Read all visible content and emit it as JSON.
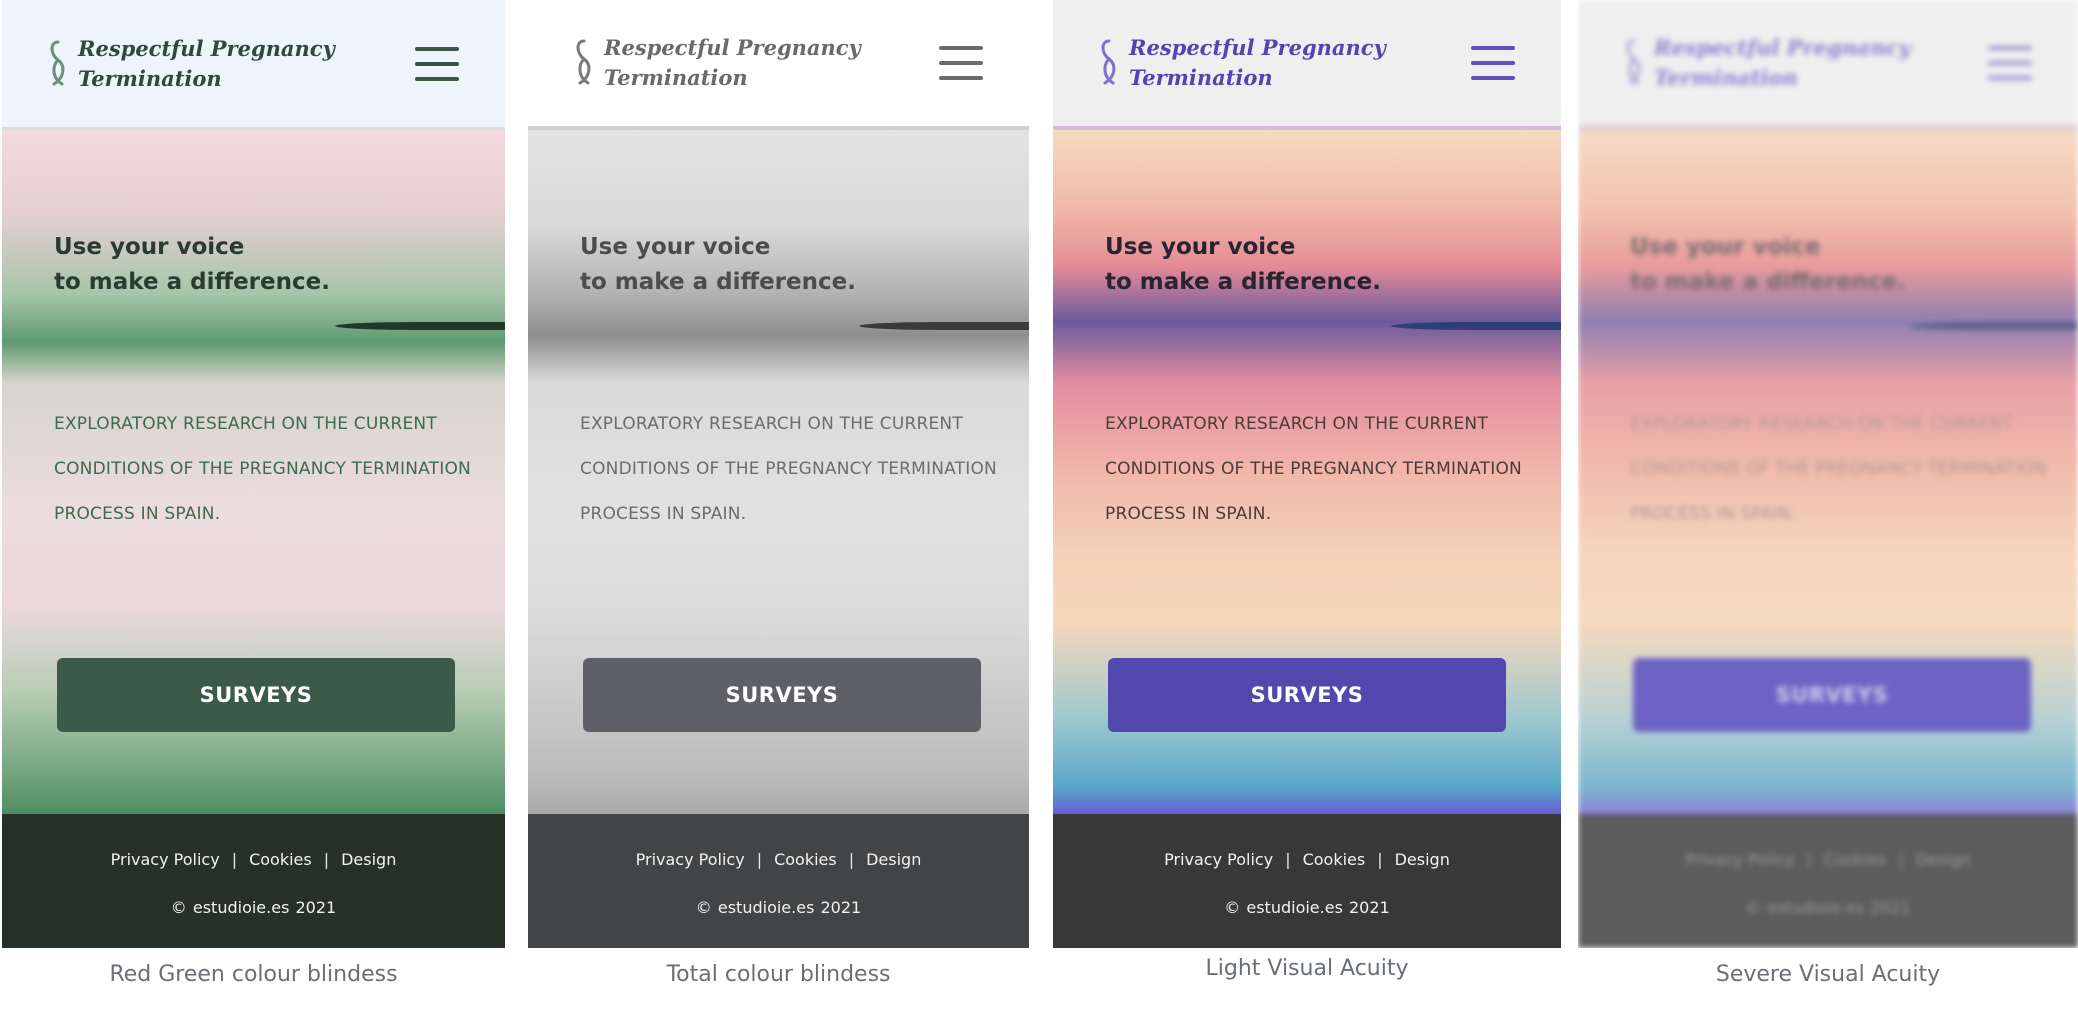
{
  "panels": [
    {
      "brand": "Respectful Pregnancy Termination",
      "tagline_line1": "Use your voice",
      "tagline_line2": "to make a difference.",
      "research_text": "EXPLORATORY RESEARCH ON THE CURRENT CONDITIONS OF THE PREGNANCY TERMINATION PROCESS IN SPAIN.",
      "surveys_button": "SURVEYS",
      "footer_links": [
        "Privacy Policy",
        "Cookies",
        "Design"
      ],
      "copyright": "© estudioie.es   2021",
      "caption": "Red Green colour blindess",
      "accent_color": "#3c5a48"
    },
    {
      "brand": "Respectful Pregnancy Termination",
      "tagline_line1": "Use your voice",
      "tagline_line2": "to make a difference.",
      "research_text": "EXPLORATORY RESEARCH ON THE CURRENT CONDITIONS OF THE PREGNANCY TERMINATION PROCESS IN SPAIN.",
      "surveys_button": "SURVEYS",
      "footer_links": [
        "Privacy Policy",
        "Cookies",
        "Design"
      ],
      "copyright": "© estudioie.es   2021",
      "caption": "Total colour blindess",
      "accent_color": "#5f6066"
    },
    {
      "brand": "Respectful Pregnancy Termination",
      "tagline_line1": "Use your voice",
      "tagline_line2": "to make a difference.",
      "research_text": "EXPLORATORY RESEARCH ON THE CURRENT CONDITIONS OF THE PREGNANCY TERMINATION PROCESS IN SPAIN.",
      "surveys_button": "SURVEYS",
      "footer_links": [
        "Privacy Policy",
        "Cookies",
        "Design"
      ],
      "copyright": "© estudioie.es   2021",
      "caption": "Light Visual Acuity",
      "accent_color": "#5348ad"
    },
    {
      "brand": "Respectful Pregnancy Termination",
      "tagline_line1": "Use your voice",
      "tagline_line2": "to make a difference.",
      "research_text": "EXPLORATORY RESEARCH ON THE CURRENT CONDITIONS OF THE PREGNANCY TERMINATION PROCESS IN SPAIN.",
      "surveys_button": "SURVEYS",
      "footer_links": [
        "Privacy Policy",
        "Cookies",
        "Design"
      ],
      "copyright": "© estudioie.es   2021",
      "caption": "Severe Visual Acuity",
      "accent_color": "#6c63c4"
    }
  ],
  "icons": {
    "logo": "ribbon-logo-icon",
    "menu": "hamburger-menu-icon"
  }
}
